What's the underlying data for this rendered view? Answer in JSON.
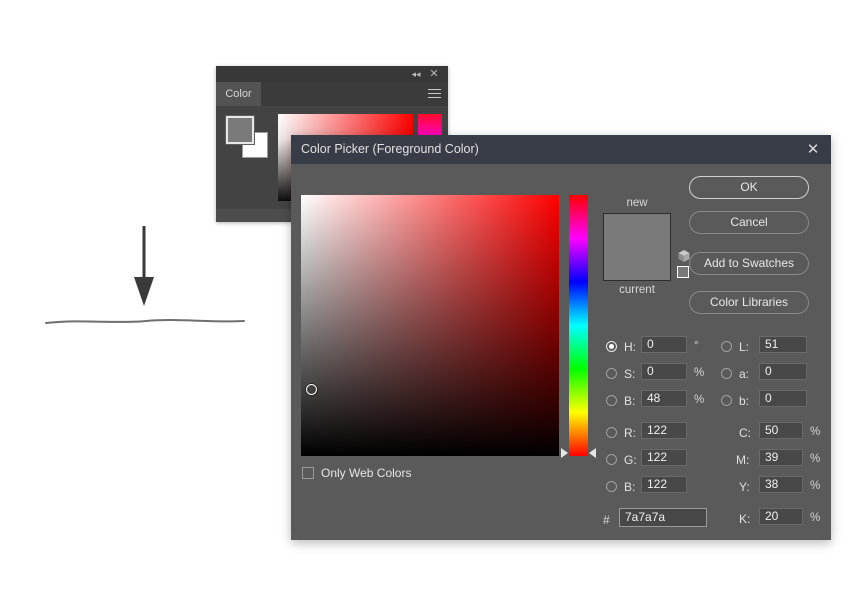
{
  "annotation": {
    "arrow": "down-arrow-annotation",
    "line": "pencil-stroke-annotation"
  },
  "color_panel": {
    "tab_label": "Color",
    "collapse_icon": "double-chevron-left-icon",
    "close_icon": "close-icon",
    "menu_icon": "panel-menu-icon",
    "foreground_color": "#7a7a7a",
    "background_color": "#ffffff"
  },
  "dialog": {
    "title": "Color Picker (Foreground Color)",
    "close_icon": "close-icon",
    "buttons": {
      "ok": "OK",
      "cancel": "Cancel",
      "add_to_swatches": "Add to Swatches",
      "color_libraries": "Color Libraries"
    },
    "preview": {
      "new_label": "new",
      "current_label": "current",
      "new_color": "#7a7a7a",
      "current_color": "#7a7a7a",
      "gamut_warning_icon": "out-of-gamut-cube-icon",
      "websafe_warning_icon": "non-web-safe-square-icon"
    },
    "only_web_colors": {
      "label": "Only Web Colors",
      "checked": false
    },
    "hsb": [
      {
        "key": "H",
        "label": "H:",
        "value": "0",
        "unit": "°",
        "selected": true
      },
      {
        "key": "S",
        "label": "S:",
        "value": "0",
        "unit": "%",
        "selected": false
      },
      {
        "key": "B",
        "label": "B:",
        "value": "48",
        "unit": "%",
        "selected": false
      }
    ],
    "lab": [
      {
        "key": "L",
        "label": "L:",
        "value": "51",
        "unit": "",
        "selected": false
      },
      {
        "key": "a",
        "label": "a:",
        "value": "0",
        "unit": "",
        "selected": false
      },
      {
        "key": "b",
        "label": "b:",
        "value": "0",
        "unit": "",
        "selected": false
      }
    ],
    "rgb": [
      {
        "key": "R",
        "label": "R:",
        "value": "122",
        "selected": false
      },
      {
        "key": "G",
        "label": "G:",
        "value": "122",
        "selected": false
      },
      {
        "key": "B",
        "label": "B:",
        "value": "122",
        "selected": false
      }
    ],
    "cmyk": [
      {
        "key": "C",
        "label": "C:",
        "value": "50",
        "unit": "%"
      },
      {
        "key": "M",
        "label": "M:",
        "value": "39",
        "unit": "%"
      },
      {
        "key": "Y",
        "label": "Y:",
        "value": "38",
        "unit": "%"
      },
      {
        "key": "K",
        "label": "K:",
        "value": "20",
        "unit": "%"
      }
    ],
    "hex": {
      "hash": "#",
      "value": "7a7a7a"
    }
  }
}
